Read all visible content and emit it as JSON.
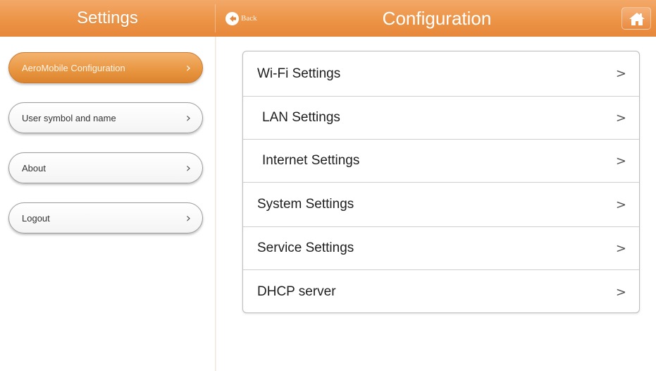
{
  "header": {
    "left_title": "Settings",
    "back_label": "Back",
    "main_title": "Configuration"
  },
  "sidebar": {
    "items": [
      {
        "label": "AeroMobile Configuration",
        "active": true
      },
      {
        "label": "User symbol and name",
        "active": false
      },
      {
        "label": "About",
        "active": false
      },
      {
        "label": "Logout",
        "active": false
      }
    ],
    "chevron": "›"
  },
  "settings_list": {
    "items": [
      {
        "label": "Wi-Fi Settings"
      },
      {
        "label": "LAN Settings"
      },
      {
        "label": "Internet Settings"
      },
      {
        "label": "System Settings"
      },
      {
        "label": "Service Settings"
      },
      {
        "label": "DHCP server"
      }
    ],
    "chevron": ">"
  },
  "colors": {
    "accent": "#ec9447",
    "header_text": "#ffffff",
    "panel_border": "#bdbdbd"
  },
  "icons": {
    "back": "back-arrow-icon",
    "home": "home-icon"
  }
}
